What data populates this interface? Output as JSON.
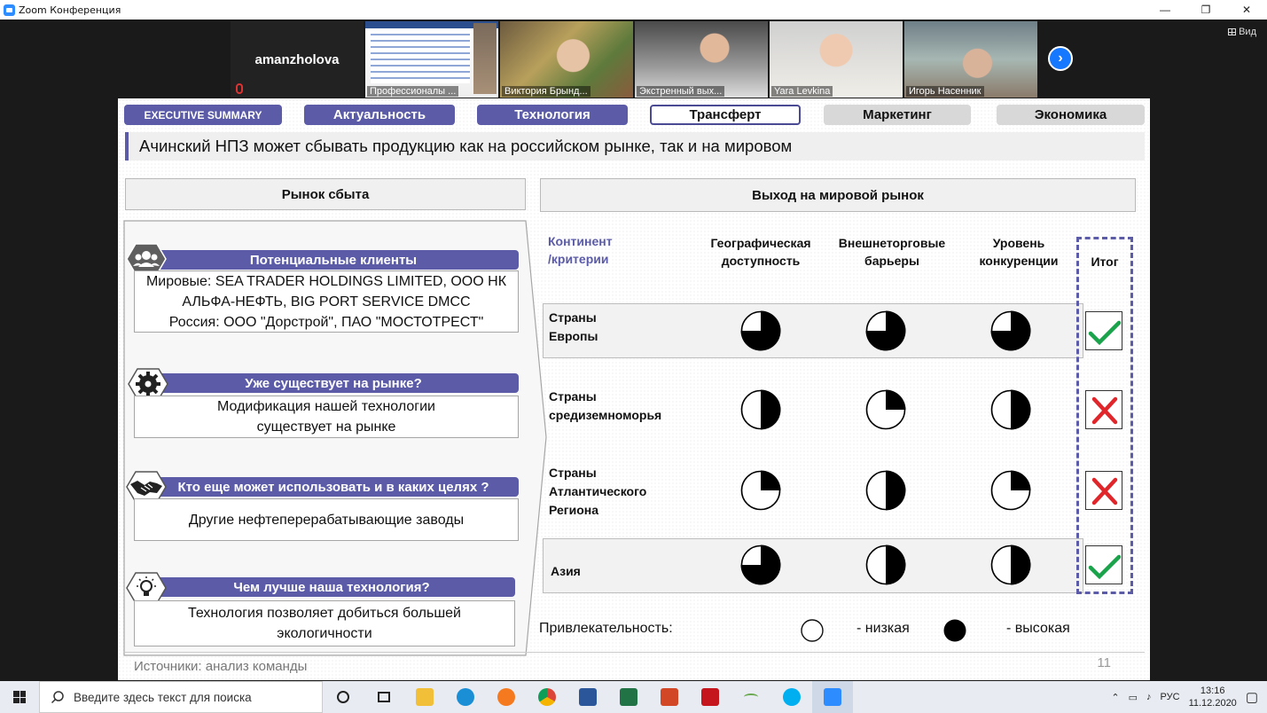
{
  "window": {
    "title": "Zoom Конференция",
    "controls": [
      "—",
      "❐",
      "✕"
    ]
  },
  "zoom": {
    "view_label": "Вид",
    "speaker_name": "amanzholova",
    "tiles": [
      {
        "name": "Профессионалы ..."
      },
      {
        "name": "Виктория Брынд..."
      },
      {
        "name": "Экстренный вых..."
      },
      {
        "name": "Yara Levkina"
      },
      {
        "name": "Игорь Насенник"
      }
    ]
  },
  "slide": {
    "tabs": [
      {
        "label": "EXECUTIVE SUMMARY",
        "state": "active"
      },
      {
        "label": "Актуальность",
        "state": "active"
      },
      {
        "label": "Технология",
        "state": "active"
      },
      {
        "label": "Трансферт",
        "state": "selected"
      },
      {
        "label": "Маркетинг",
        "state": "inactive"
      },
      {
        "label": "Экономика",
        "state": "inactive"
      }
    ],
    "headline": "Ачинский НПЗ может сбывать продукцию как на российском рынке, так и на мировом",
    "left_title": "Рынок сбыта",
    "right_title": "Выход на мировой рынок",
    "left_items": [
      {
        "icon": "people-icon",
        "title": "Потенциальные клиенты",
        "lines": [
          "Мировые: SEA TRADER HOLDINGS LIMITED, ООО НК",
          "АЛЬФА-НЕФТЬ, BIG PORT SERVICE DMCC",
          "Россия: ООО \"Дорстрой\", ПАО \"МОСТОТРЕСТ\""
        ]
      },
      {
        "icon": "gear-icon",
        "title": "Уже существует на рынке?",
        "lines": [
          "Модификация нашей технологии",
          "существует на рынке"
        ]
      },
      {
        "icon": "handshake-icon",
        "title": "Кто еще может использовать и в каких целях ?",
        "lines": [
          "Другие нефтеперерабатывающие заводы"
        ]
      },
      {
        "icon": "lightbulb-icon",
        "title": "Чем лучше наша технология?",
        "lines": [
          "Технология позволяет добиться большей",
          "экологичности"
        ]
      }
    ],
    "table": {
      "criteria_header_1": "Континент",
      "criteria_header_2": "/критерии",
      "columns": [
        {
          "line1": "Географическая",
          "line2": "доступность"
        },
        {
          "line1": "Внешнеторговые",
          "line2": "барьеры"
        },
        {
          "line1": "Уровень",
          "line2": "конкуренции"
        }
      ],
      "result_header": "Итог",
      "rows": [
        {
          "lines": [
            "Страны",
            "Европы"
          ],
          "scores": [
            0.75,
            0.75,
            0.75
          ],
          "result": "check"
        },
        {
          "lines": [
            "Страны",
            "средиземноморья"
          ],
          "scores": [
            0.5,
            0.25,
            0.5
          ],
          "result": "cross"
        },
        {
          "lines": [
            "Страны",
            "Атлантического",
            "Региона"
          ],
          "scores": [
            0.25,
            0.5,
            0.25
          ],
          "result": "cross"
        },
        {
          "lines": [
            "Азия"
          ],
          "scores": [
            0.75,
            0.5,
            0.5
          ],
          "result": "check"
        }
      ]
    },
    "legend": {
      "label": "Привлекательность:",
      "low": "- низкая",
      "high": "- высокая"
    },
    "source": "Источники: анализ команды",
    "page": "11"
  },
  "colors": {
    "accent": "#5b5ba8",
    "check": "#1aa34a",
    "cross": "#e0262a"
  },
  "taskbar": {
    "search_placeholder": "Введите здесь текст для поиска",
    "lang": "РУС",
    "time": "13:16",
    "date": "11.12.2020"
  }
}
